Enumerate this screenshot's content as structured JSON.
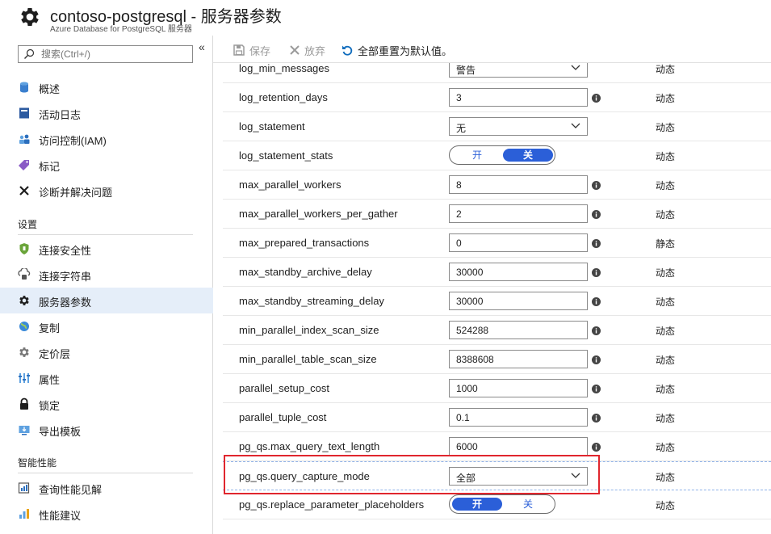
{
  "header": {
    "title": "contoso-postgresql - 服务器参数",
    "subtitle": "Azure Database for PostgreSQL 服务器"
  },
  "sidebar": {
    "search_placeholder": "搜索(Ctrl+/)",
    "collapse_label": "«",
    "items": [
      {
        "label": "概述",
        "icon": "database-icon"
      },
      {
        "label": "活动日志",
        "icon": "activity-log-icon"
      },
      {
        "label": "访问控制(IAM)",
        "icon": "users-icon"
      },
      {
        "label": "标记",
        "icon": "tag-icon"
      },
      {
        "label": "诊断并解决问题",
        "icon": "wrench-icon"
      }
    ],
    "sections": [
      {
        "heading": "设置",
        "items": [
          {
            "label": "连接安全性",
            "icon": "shield-icon"
          },
          {
            "label": "连接字符串",
            "icon": "connection-string-icon"
          },
          {
            "label": "服务器参数",
            "icon": "gear-icon",
            "active": true
          },
          {
            "label": "复制",
            "icon": "globe-icon"
          },
          {
            "label": "定价层",
            "icon": "pricing-gear-icon"
          },
          {
            "label": "属性",
            "icon": "properties-icon"
          },
          {
            "label": "锁定",
            "icon": "lock-icon"
          },
          {
            "label": "导出模板",
            "icon": "export-template-icon"
          }
        ]
      },
      {
        "heading": "智能性能",
        "items": [
          {
            "label": "查询性能见解",
            "icon": "query-insight-icon"
          },
          {
            "label": "性能建议",
            "icon": "performance-recommendation-icon"
          }
        ]
      }
    ]
  },
  "toolbar": {
    "save_label": "保存",
    "discard_label": "放弃",
    "reset_label": "全部重置为默认值。"
  },
  "parameters": [
    {
      "name": "log_min_messages",
      "control": "dropdown",
      "value": "警告",
      "info": false,
      "type": "动态"
    },
    {
      "name": "log_retention_days",
      "control": "text",
      "value": "3",
      "info": true,
      "type": "动态"
    },
    {
      "name": "log_statement",
      "control": "dropdown",
      "value": "无",
      "info": false,
      "type": "动态"
    },
    {
      "name": "log_statement_stats",
      "control": "toggle",
      "on_label": "开",
      "off_label": "关",
      "value": "关",
      "info": false,
      "type": "动态"
    },
    {
      "name": "max_parallel_workers",
      "control": "text",
      "value": "8",
      "info": true,
      "type": "动态"
    },
    {
      "name": "max_parallel_workers_per_gather",
      "control": "text",
      "value": "2",
      "info": true,
      "type": "动态"
    },
    {
      "name": "max_prepared_transactions",
      "control": "text",
      "value": "0",
      "info": true,
      "type": "静态"
    },
    {
      "name": "max_standby_archive_delay",
      "control": "text",
      "value": "30000",
      "info": true,
      "type": "动态"
    },
    {
      "name": "max_standby_streaming_delay",
      "control": "text",
      "value": "30000",
      "info": true,
      "type": "动态"
    },
    {
      "name": "min_parallel_index_scan_size",
      "control": "text",
      "value": "524288",
      "info": true,
      "type": "动态"
    },
    {
      "name": "min_parallel_table_scan_size",
      "control": "text",
      "value": "8388608",
      "info": true,
      "type": "动态"
    },
    {
      "name": "parallel_setup_cost",
      "control": "text",
      "value": "1000",
      "info": true,
      "type": "动态"
    },
    {
      "name": "parallel_tuple_cost",
      "control": "text",
      "value": "0.1",
      "info": true,
      "type": "动态"
    },
    {
      "name": "pg_qs.max_query_text_length",
      "control": "text",
      "value": "6000",
      "info": true,
      "type": "动态"
    },
    {
      "name": "pg_qs.query_capture_mode",
      "control": "dropdown",
      "value": "全部",
      "info": false,
      "type": "动态",
      "highlighted": true
    },
    {
      "name": "pg_qs.replace_parameter_placeholders",
      "control": "toggle",
      "on_label": "开",
      "off_label": "关",
      "value": "开",
      "info": false,
      "type": "动态"
    }
  ],
  "colors": {
    "accent": "#2b5fd8",
    "active_nav_bg": "#e5eef9",
    "highlight_border": "#e0262e"
  }
}
